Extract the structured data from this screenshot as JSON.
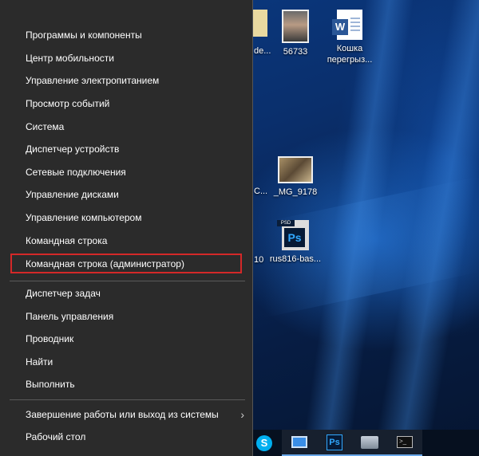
{
  "desktop": {
    "icons": [
      {
        "label": "56733",
        "kind": "photo"
      },
      {
        "label": "Кошка перегрыз...",
        "kind": "word-doc"
      },
      {
        "label": "_MG_9178",
        "kind": "photo"
      },
      {
        "label": "rus816-bas...",
        "kind": "psd"
      }
    ],
    "partial_labels": [
      "de...",
      "C...",
      "10"
    ]
  },
  "context_menu": {
    "group1": [
      "Программы и компоненты",
      "Центр мобильности",
      "Управление электропитанием",
      "Просмотр событий",
      "Система",
      "Диспетчер устройств",
      "Сетевые подключения",
      "Управление дисками",
      "Управление компьютером",
      "Командная строка",
      "Командная строка (администратор)"
    ],
    "group2": [
      "Диспетчер задач",
      "Панель управления",
      "Проводник",
      "Найти",
      "Выполнить"
    ],
    "group3": [
      "Завершение работы или выход из системы",
      "Рабочий стол"
    ],
    "highlighted_item": "Командная строка (администратор)",
    "highlight_color": "#d42828"
  },
  "taskbar": {
    "icons": [
      "skype-icon",
      "remote-desktop-icon",
      "photoshop-icon",
      "network-icon",
      "command-prompt-icon"
    ]
  }
}
